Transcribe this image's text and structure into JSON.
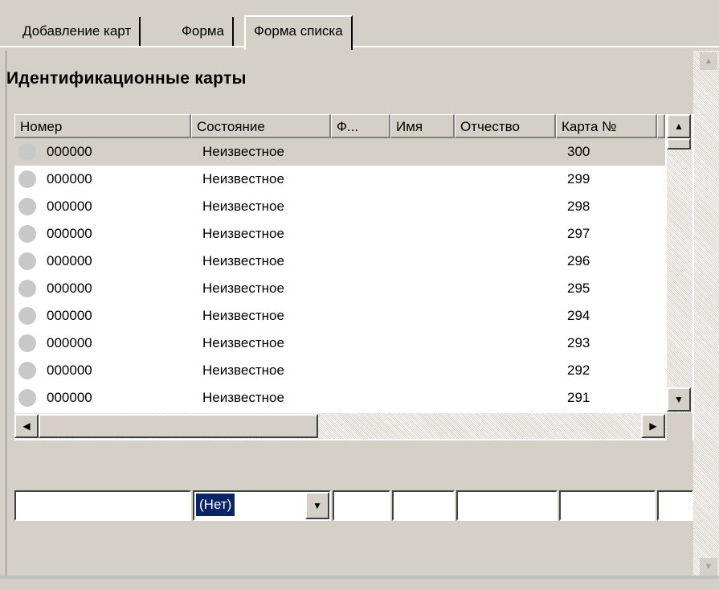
{
  "tabs": [
    {
      "label": "Добавление карт"
    },
    {
      "label": "Форма"
    },
    {
      "label": "Форма списка"
    }
  ],
  "page": {
    "title": "Идентификационные карты"
  },
  "grid": {
    "columns": [
      "Номер",
      "Состояние",
      "Ф...",
      "Имя",
      "Отчество",
      "Карта №"
    ],
    "rows": [
      {
        "number": "000000",
        "state": "Неизвестное",
        "card": "300"
      },
      {
        "number": "000000",
        "state": "Неизвестное",
        "card": "299"
      },
      {
        "number": "000000",
        "state": "Неизвестное",
        "card": "298"
      },
      {
        "number": "000000",
        "state": "Неизвестное",
        "card": "297"
      },
      {
        "number": "000000",
        "state": "Неизвестное",
        "card": "296"
      },
      {
        "number": "000000",
        "state": "Неизвестное",
        "card": "295"
      },
      {
        "number": "000000",
        "state": "Неизвестное",
        "card": "294"
      },
      {
        "number": "000000",
        "state": "Неизвестное",
        "card": "293"
      },
      {
        "number": "000000",
        "state": "Неизвестное",
        "card": "292"
      },
      {
        "number": "000000",
        "state": "Неизвестное",
        "card": "291"
      }
    ]
  },
  "filters": {
    "state_select": {
      "value": "(Нет)"
    }
  },
  "icons": {
    "status": "status-dot-icon",
    "up": "arrow-up-icon",
    "down": "arrow-down-icon",
    "left": "arrow-left-icon",
    "right": "arrow-right-icon",
    "dropdown": "chevron-down-icon"
  },
  "colors": {
    "window": "#d4d0c8",
    "selection": "#0a246a",
    "status_dot": "#c8c8c8"
  }
}
